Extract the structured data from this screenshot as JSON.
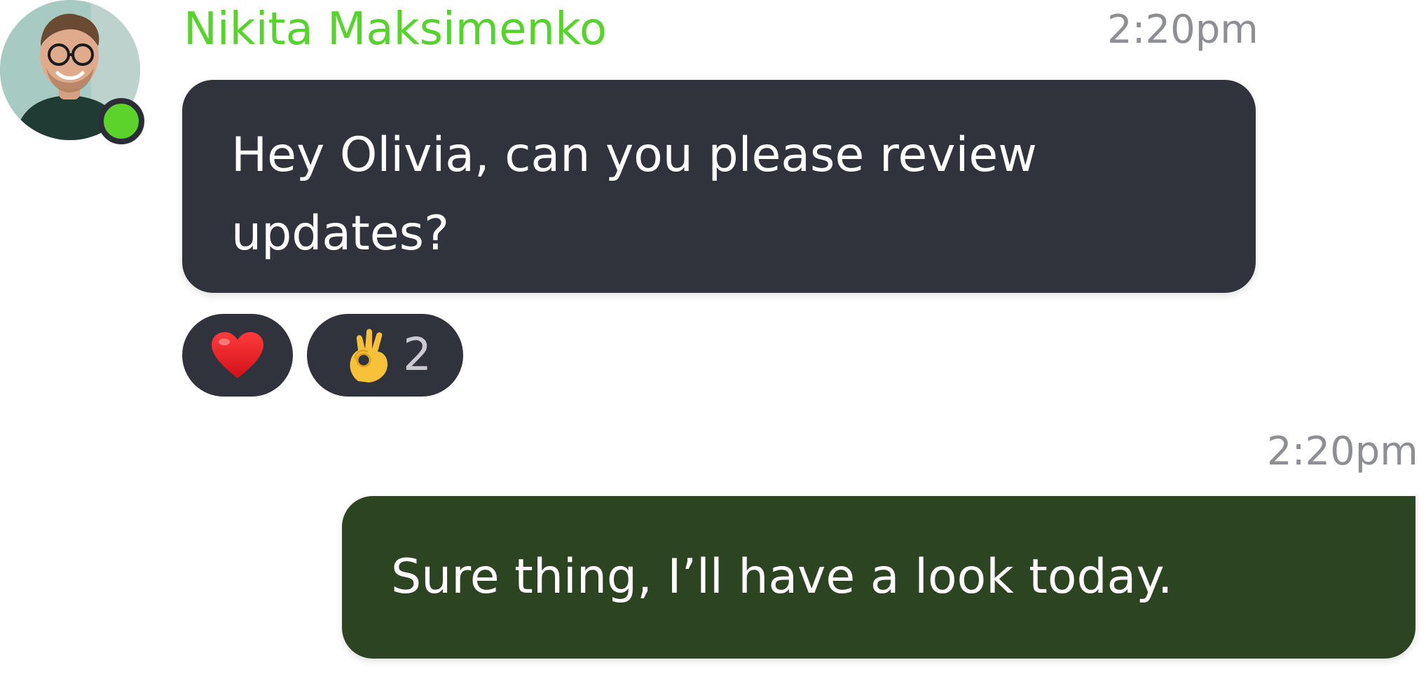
{
  "incoming": {
    "sender_name": "Nikita Maksimenko",
    "time": "2:20pm",
    "status": "online",
    "text": "Hey Olivia, can you please review updates?",
    "reactions": [
      {
        "icon": "red-heart-emoji",
        "count": ""
      },
      {
        "icon": "ok-hand-emoji",
        "count": "2"
      }
    ]
  },
  "outgoing": {
    "time": "2:20pm",
    "text": "Sure thing, I’ll have a look today."
  },
  "colors": {
    "online": "#5cd32a",
    "sender_name": "#57d22e",
    "incoming_bubble": "#30333b",
    "outgoing_bubble": "#2c4422",
    "timestamp": "#8d8f94"
  }
}
